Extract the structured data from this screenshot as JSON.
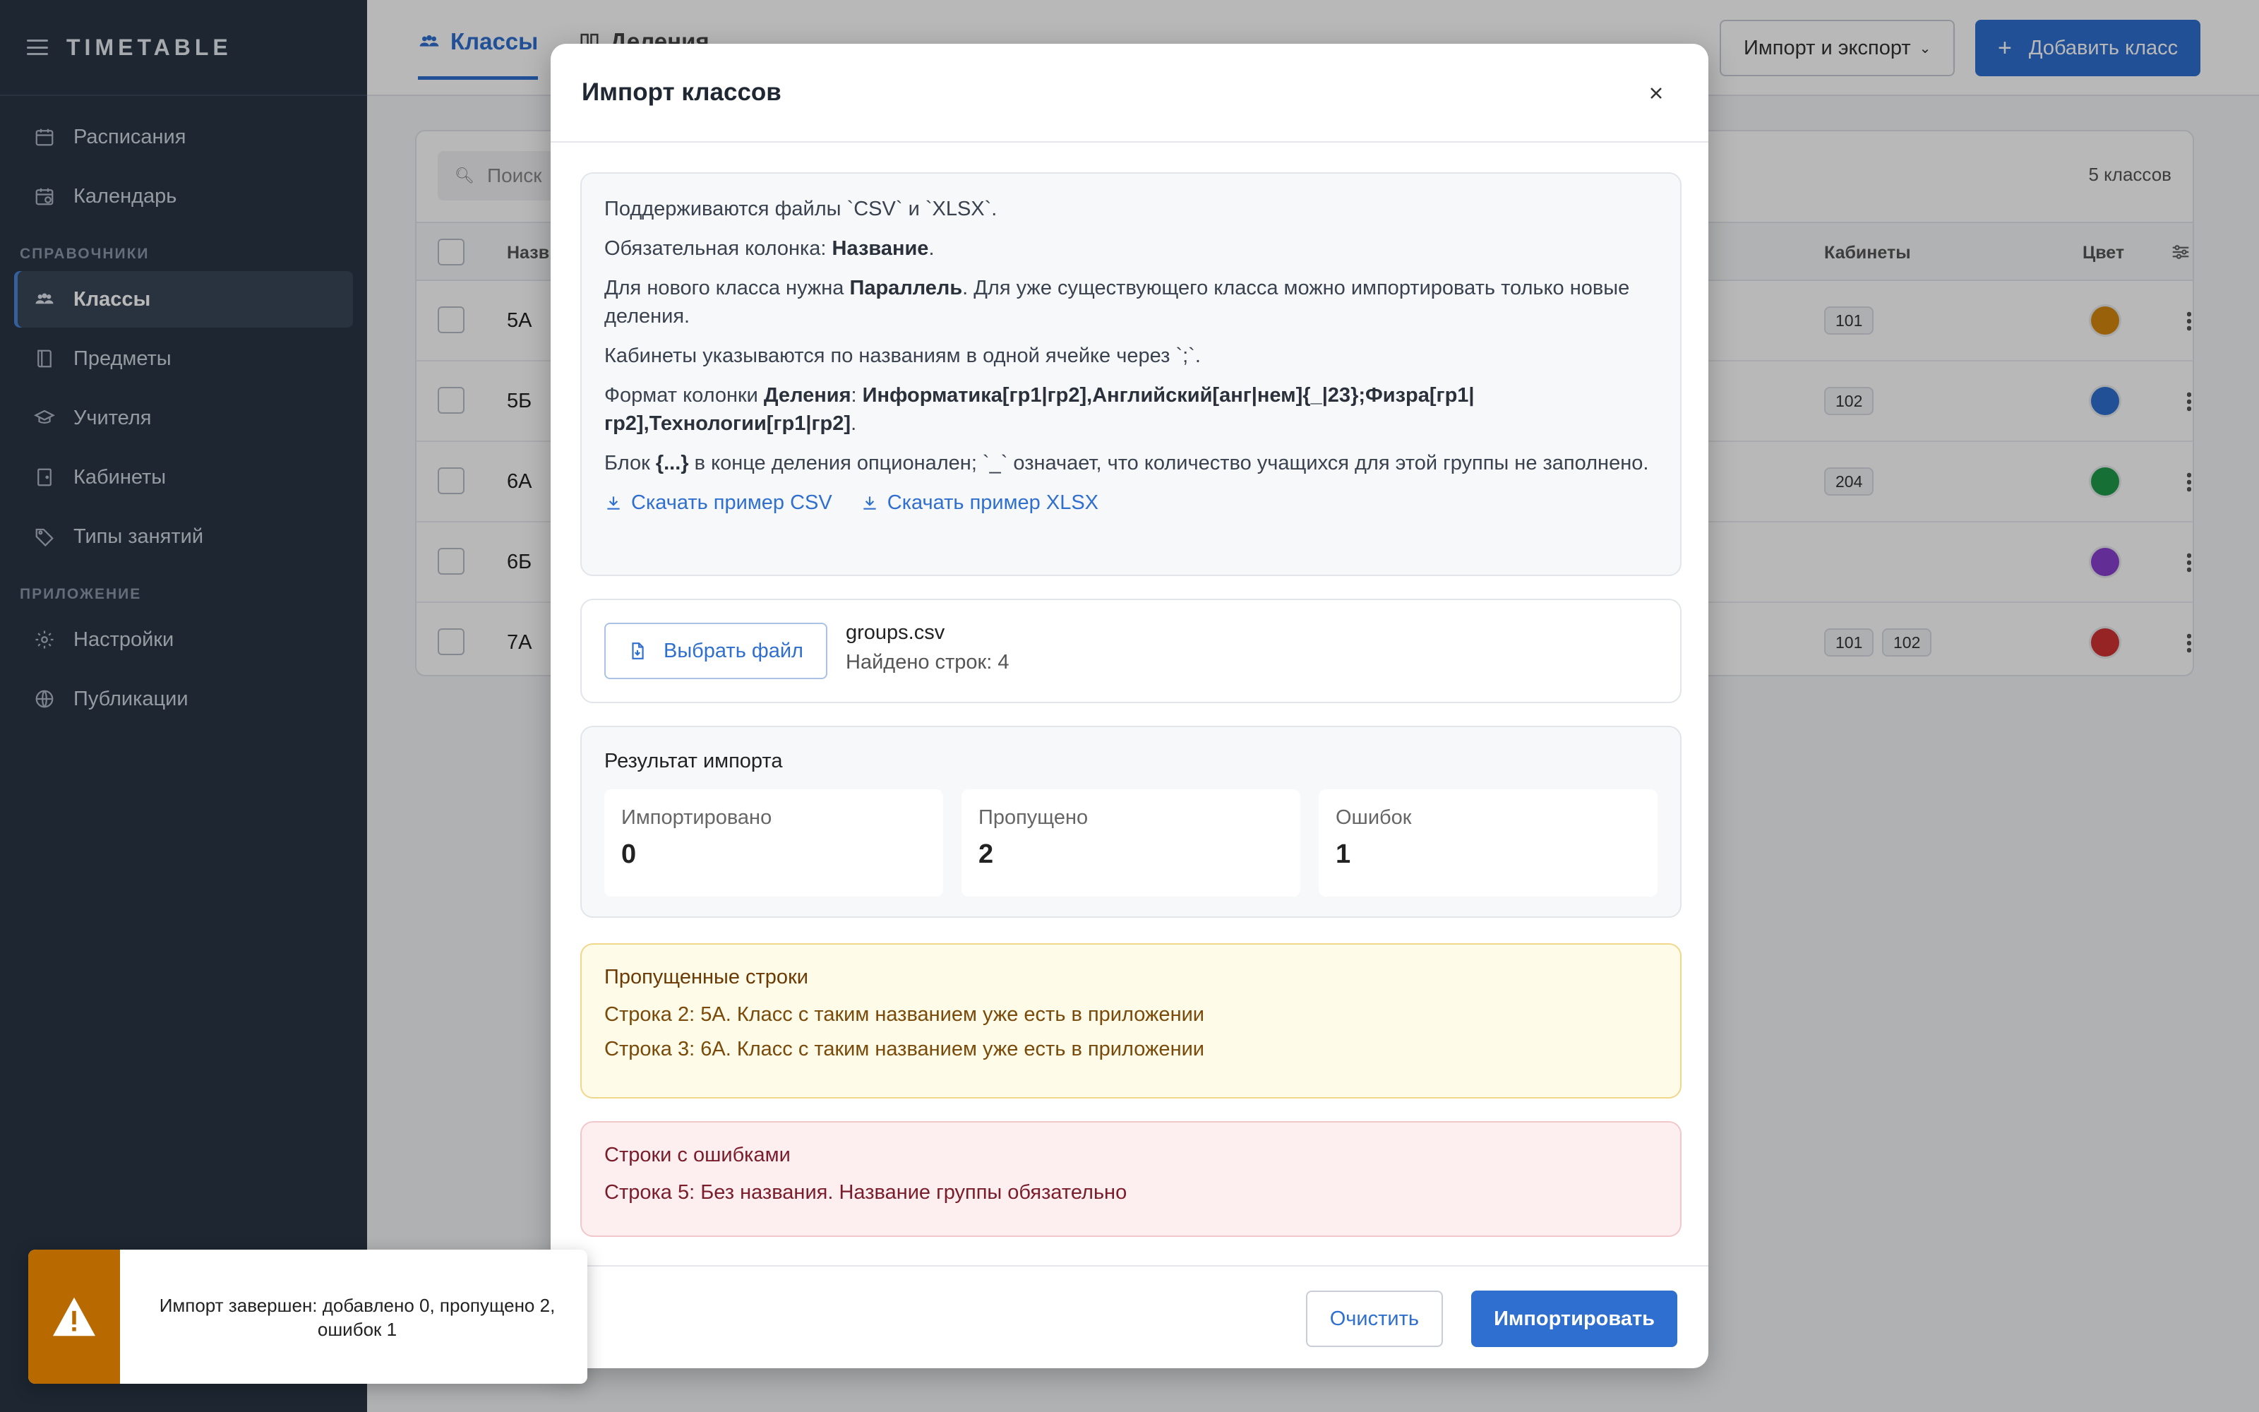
{
  "app": {
    "title": "TIMETABLE"
  },
  "sidebar": {
    "items_top": [
      {
        "label": "Расписания",
        "icon": "calendar-grid-icon"
      },
      {
        "label": "Календарь",
        "icon": "calendar-clock-icon"
      }
    ],
    "section1": "СПРАВОЧНИКИ",
    "items_ref": [
      {
        "label": "Классы",
        "icon": "users-icon",
        "active": true
      },
      {
        "label": "Предметы",
        "icon": "book-icon"
      },
      {
        "label": "Учителя",
        "icon": "graduation-cap-icon"
      },
      {
        "label": "Кабинеты",
        "icon": "door-icon"
      },
      {
        "label": "Типы занятий",
        "icon": "tag-icon"
      }
    ],
    "section2": "ПРИЛОЖЕНИЕ",
    "items_app": [
      {
        "label": "Настройки",
        "icon": "gear-icon"
      },
      {
        "label": "Публикации",
        "icon": "globe-icon"
      }
    ]
  },
  "topbar": {
    "tabs": [
      {
        "label": "Классы"
      },
      {
        "label": "Деления"
      }
    ],
    "import_export": "Импорт и экспорт",
    "add_class": "Добавить класс"
  },
  "table": {
    "search_placeholder": "Поиск",
    "count": "5 классов",
    "headers": {
      "name": "Назв",
      "rooms": "Кабинеты",
      "color": "Цвет"
    },
    "rows": [
      {
        "name": "5А",
        "rooms": [
          "101"
        ],
        "color": "#d4880f"
      },
      {
        "name": "5Б",
        "rooms": [
          "102"
        ],
        "color": "#2f6fd0"
      },
      {
        "name": "6А",
        "rooms": [
          "204"
        ],
        "color": "#1f9a4a"
      },
      {
        "name": "6Б",
        "rooms": [],
        "color": "#8a3fd0"
      },
      {
        "name": "7А",
        "rooms": [
          "101",
          "102"
        ],
        "color": "#d03232"
      }
    ]
  },
  "modal": {
    "title": "Импорт классов",
    "info": {
      "p1": "Поддерживаются файлы `CSV` и `XLSX`.",
      "p2_a": "Обязательная колонка: ",
      "p2_b": "Название",
      "p2_c": ".",
      "p3_a": "Для нового класса нужна ",
      "p3_b": "Параллель",
      "p3_c": ". Для уже существующего класса можно импортировать только новые деления.",
      "p4": "Кабинеты указываются по названиям в одной ячейке через `;`.",
      "p5_a": "Формат колонки ",
      "p5_b": "Деления",
      "p5_c": ": ",
      "p5_d": "Информатика[гр1|гр2],Английский[анг|нем]{_|23};Физра[гр1|гр2],Технологии[гр1|гр2]",
      "p5_e": ".",
      "p6_a": "Блок ",
      "p6_b": "{...}",
      "p6_c": " в конце деления опционален; `_` означает, что количество учащихся для этой группы не заполнено.",
      "dl_csv": "Скачать пример CSV",
      "dl_xlsx": "Скачать пример XLSX"
    },
    "file": {
      "button": "Выбрать файл",
      "name": "groups.csv",
      "rows": "Найдено строк: 4"
    },
    "result": {
      "title": "Результат импорта",
      "imported_label": "Импортировано",
      "imported": "0",
      "skipped_label": "Пропущено",
      "skipped": "2",
      "errors_label": "Ошибок",
      "errors": "1"
    },
    "skipped": {
      "title": "Пропущенные строки",
      "lines": [
        "Строка 2: 5А. Класс с таким названием уже есть в приложении",
        "Строка 3: 6А. Класс с таким названием уже есть в приложении"
      ]
    },
    "errors": {
      "title": "Строки с ошибками",
      "lines": [
        "Строка 5: Без названия. Название группы обязательно"
      ]
    },
    "footer": {
      "clear": "Очистить",
      "import": "Импортировать"
    }
  },
  "toast": {
    "text": "Импорт завершен: добавлено 0, пропущено 2, ошибок 1",
    "color": "#b86a00"
  }
}
